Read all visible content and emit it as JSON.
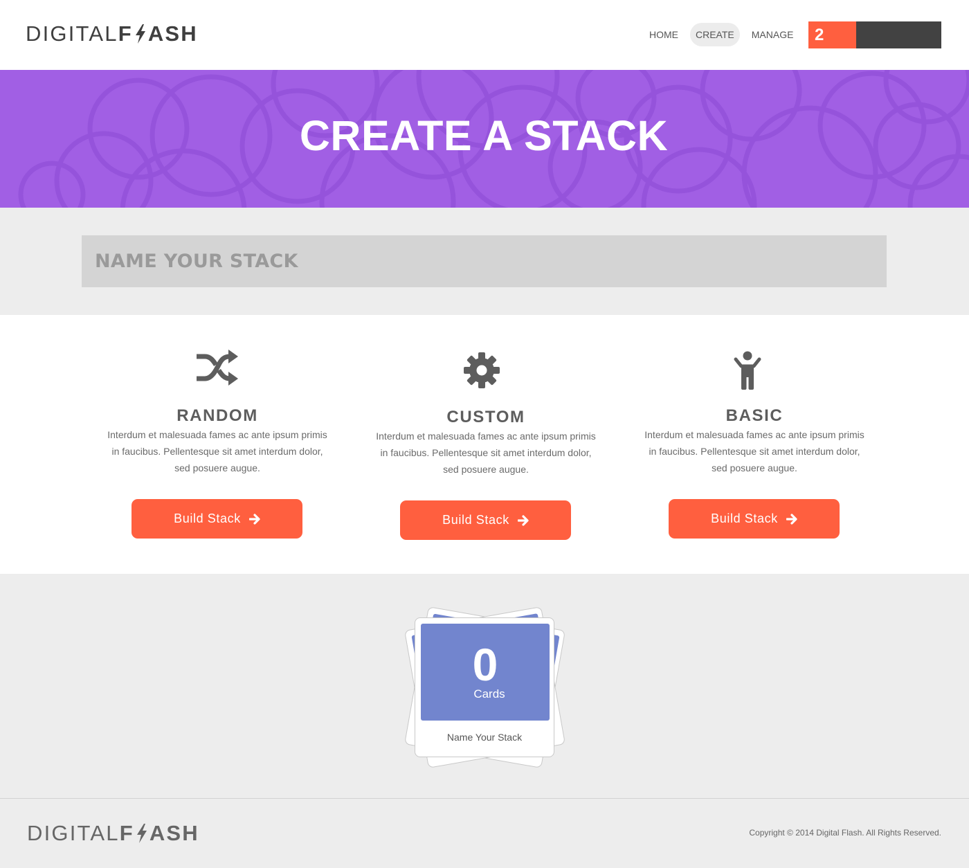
{
  "brand": {
    "light": "DIGITAL",
    "bold_prefix": "F",
    "bold_suffix": "ASH"
  },
  "nav": {
    "items": [
      {
        "label": "HOME",
        "active": false
      },
      {
        "label": "CREATE",
        "active": true
      },
      {
        "label": "MANAGE",
        "active": false
      }
    ]
  },
  "cart": {
    "count": "2"
  },
  "hero": {
    "title": "CREATE A STACK"
  },
  "stack_name": {
    "placeholder": "NAME YOUR STACK"
  },
  "options": [
    {
      "title": "RANDOM",
      "icon": "shuffle-icon",
      "description": "Interdum et malesuada fames ac ante ipsum primis in faucibus. Pellentesque sit amet interdum dolor, sed posuere augue.",
      "button": "Build Stack"
    },
    {
      "title": "CUSTOM",
      "icon": "gear-icon",
      "description": "Interdum et malesuada fames ac ante ipsum primis in faucibus. Pellentesque sit amet interdum dolor, sed posuere augue.",
      "button": "Build Stack"
    },
    {
      "title": "BASIC",
      "icon": "person-icon",
      "description": "Interdum et malesuada fames ac ante ipsum primis in faucibus. Pellentesque sit amet interdum dolor, sed posuere augue.",
      "button": "Build Stack"
    }
  ],
  "preview": {
    "count": "0",
    "count_label": "Cards",
    "name": "Name Your Stack"
  },
  "footer": {
    "copyright": "Copyright ©  2014 Digital Flash.  All Rights Reserved."
  },
  "colors": {
    "accent": "#ff5f3f",
    "hero": "#a15fe4",
    "card": "#7285ce",
    "dark": "#424242"
  }
}
